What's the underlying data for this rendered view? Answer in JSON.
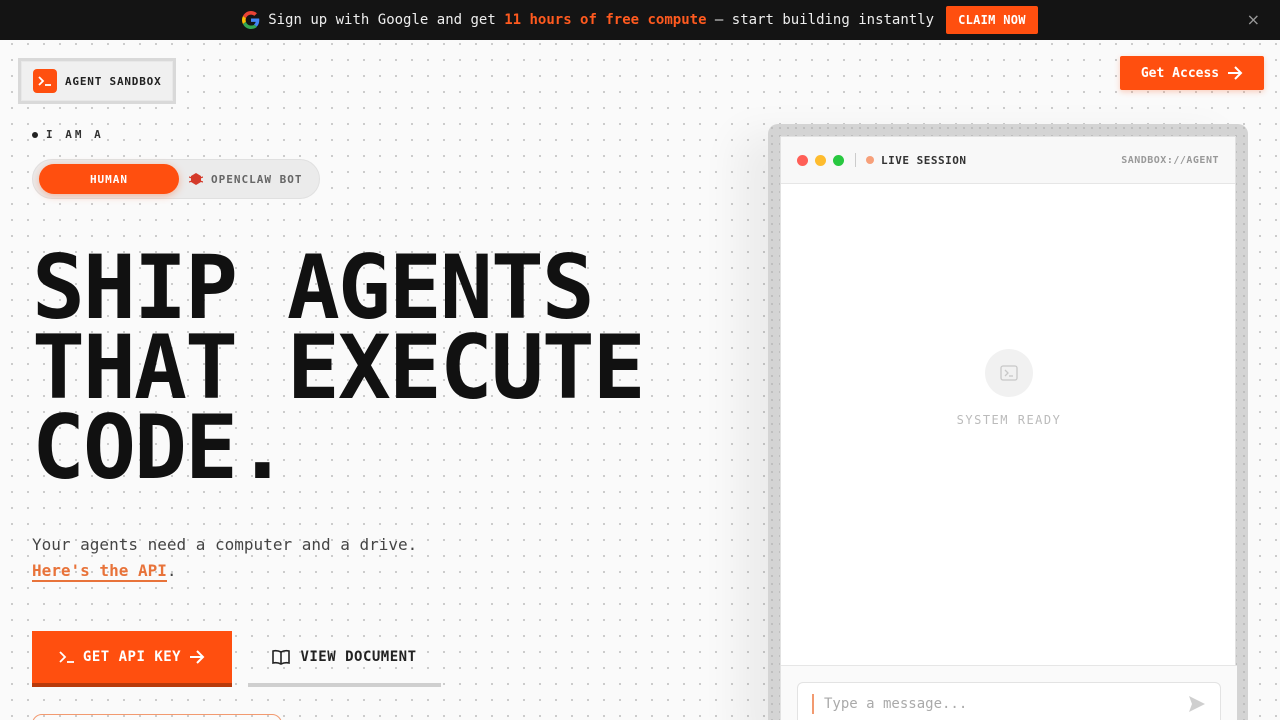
{
  "banner": {
    "text_before": "Sign up with Google and get ",
    "highlight": "11 hours of free compute",
    "text_after": " — start building instantly",
    "claim_label": "CLAIM NOW",
    "close_icon": "×"
  },
  "logo": {
    "text": "AGENT SANDBOX"
  },
  "header": {
    "get_access_label": "Get Access"
  },
  "identity": {
    "prompt": "I AM A",
    "options": [
      "HUMAN",
      "OPENCLAW BOT"
    ],
    "selected": "HUMAN"
  },
  "hero": {
    "lines": [
      "SHIP AGENTS",
      "THAT EXECUTE",
      "CODE."
    ]
  },
  "tagline": {
    "text": "Your agents need a computer and a drive.",
    "link": "Here's the API",
    "suffix": "."
  },
  "cta": {
    "api_key_label": "GET API KEY",
    "doc_label": "VIEW DOCUMENT"
  },
  "session": {
    "status": "LIVE SESSION",
    "address": "SANDBOX://AGENT",
    "empty_state": "SYSTEM READY",
    "input_placeholder": "Type a message..."
  },
  "colors": {
    "accent": "#ff4f0f",
    "banner_bg": "#141414",
    "traffic_red": "#ff5f57",
    "traffic_yellow": "#febc2e",
    "traffic_green": "#28c840"
  }
}
